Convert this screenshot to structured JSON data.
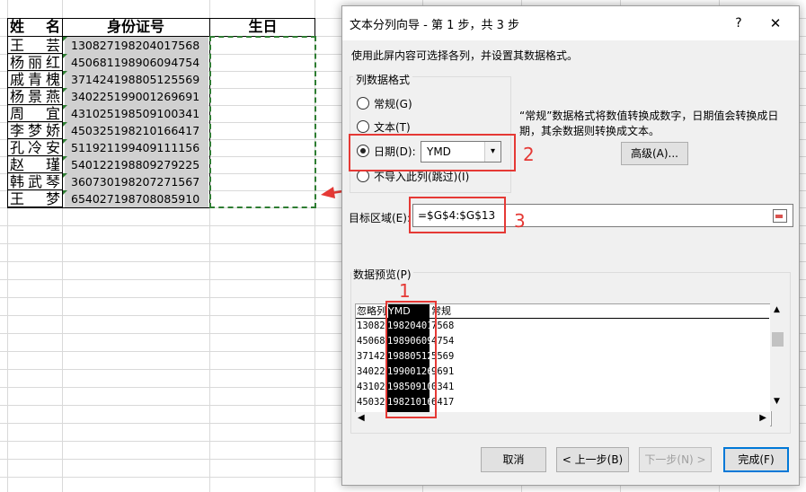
{
  "sheet": {
    "header_name": "姓　名",
    "header_id": "身份证号",
    "header_birth": "生日",
    "rows": [
      {
        "name": "王　芸",
        "id": "130827198204017568"
      },
      {
        "name": "杨丽红",
        "id": "450681198906094754"
      },
      {
        "name": "戚青槐",
        "id": "371424198805125569"
      },
      {
        "name": "杨景燕",
        "id": "340225199001269691"
      },
      {
        "name": "周　宜",
        "id": "431025198509100341"
      },
      {
        "name": "李梦娇",
        "id": "450325198210166417"
      },
      {
        "name": "孔冷安",
        "id": "511921199409111156"
      },
      {
        "name": "赵　瑾",
        "id": "540122198809279225"
      },
      {
        "name": "韩武琴",
        "id": "360730198207271567"
      },
      {
        "name": "王　梦",
        "id": "654027198708085910"
      }
    ]
  },
  "dialog": {
    "title": "文本分列向导 - 第 1 步，共 3 步",
    "help": "?",
    "close": "✕",
    "instruction": "使用此屏内容可选择各列，并设置其数据格式。",
    "format_group": "列数据格式",
    "options": {
      "general": "常规(G)",
      "text": "文本(T)",
      "date": "日期(D):",
      "skip": "不导入此列(跳过)(I)"
    },
    "selected_option": "date",
    "date_format": "YMD",
    "description": "“常规”数据格式将数值转换成数字，日期值会转换成日期，其余数据则转换成文本。",
    "advanced": "高级(A)...",
    "dest_label": "目标区域(E):",
    "dest_value": "=$G$4:$G$13",
    "preview_label": "数据预览(P)",
    "preview_headers": [
      "忽略列",
      "YMD",
      "常规"
    ],
    "preview_rows": [
      [
        "13082",
        "19820401",
        "7568"
      ],
      [
        "45068",
        "19890609",
        "4754"
      ],
      [
        "37142",
        "19880512",
        "5569"
      ],
      [
        "34022",
        "19900126",
        "9691"
      ],
      [
        "43102",
        "19850910",
        "0341"
      ],
      [
        "45032",
        "19821016",
        "6417"
      ]
    ],
    "buttons": {
      "cancel": "取消",
      "back": "< 上一步(B)",
      "next": "下一步(N) >",
      "finish": "完成(F)"
    }
  },
  "annotations": {
    "n1": "1",
    "n2": "2",
    "n3": "3"
  },
  "colors": {
    "annotation_red": "#e53935",
    "selection_green": "#2e7d32",
    "cell_gray": "#d0d0d0"
  }
}
